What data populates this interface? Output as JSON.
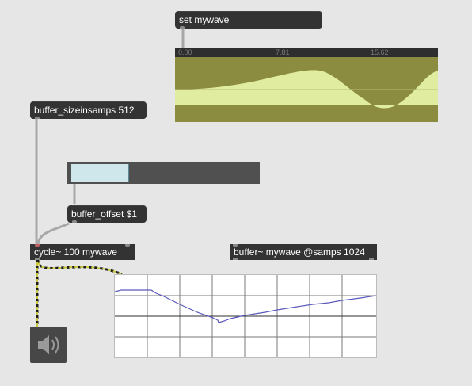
{
  "messages": {
    "set_mywave": "set mywave",
    "buffer_sizeinsamps": "buffer_sizeinsamps 512",
    "buffer_offset": "buffer_offset $1"
  },
  "objects": {
    "cycle": "cycle~ 100 mywave",
    "buffer": "buffer~ mywave @samps 1024"
  },
  "waveform": {
    "ruler_labels": [
      "0.00",
      "7.81",
      "15.62"
    ],
    "bg_color": "#8c8c40",
    "wave_color": "#e0eca0"
  },
  "slider": {
    "value_fraction": 0.31,
    "fill_color": "#cfe6ea"
  },
  "scope": {
    "trace_color": "#5b5bbd"
  },
  "speaker": {
    "icon": "speaker-icon"
  }
}
